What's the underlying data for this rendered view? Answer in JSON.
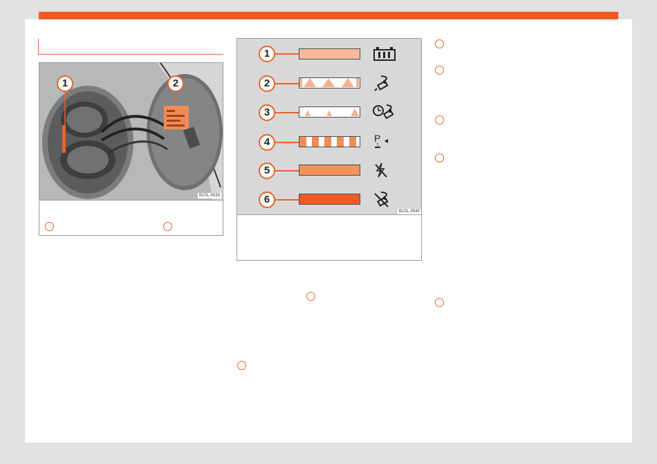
{
  "figures": {
    "fig1": {
      "code": "B1SL-0539",
      "callouts": [
        "1",
        "2"
      ]
    },
    "fig2": {
      "code": "B1SL-0540",
      "callouts": [
        "1",
        "2",
        "3",
        "4",
        "5",
        "6"
      ]
    }
  },
  "status_rows": [
    {
      "index": "1",
      "pattern": "solid",
      "fill": "#f8b99a",
      "icon": "battery-icon"
    },
    {
      "index": "2",
      "pattern": "triangles",
      "fill": "#f6b08d",
      "icon": "charging-plug-icon"
    },
    {
      "index": "3",
      "pattern": "small-triangles",
      "fill": "#f6b08d",
      "icon": "timer-charging-icon"
    },
    {
      "index": "4",
      "pattern": "dashed",
      "fill": "#f28b55",
      "icon": "parking-lock-icon"
    },
    {
      "index": "5",
      "pattern": "solid",
      "fill": "#f5925c",
      "icon": "no-power-icon"
    },
    {
      "index": "6",
      "pattern": "solid",
      "fill": "#f05a22",
      "icon": "charging-error-icon"
    }
  ],
  "colors": {
    "accent": "#f05a22",
    "page_bg": "#ffffff",
    "outer_bg": "#e2e2e2"
  }
}
